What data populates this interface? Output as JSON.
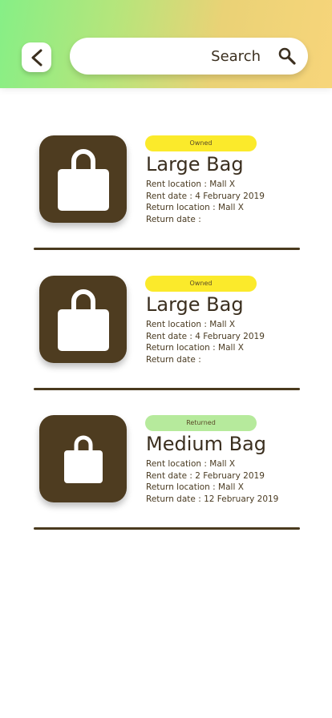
{
  "search": {
    "placeholder": "Search"
  },
  "colors": {
    "owned": "#fbea2b",
    "returned": "#b6ea9c",
    "thumb": "#4e3c20",
    "divider": "#4a3a1e"
  },
  "items": [
    {
      "status": "Owned",
      "title": "Large Bag",
      "rent_location": "Rent location : Mall X",
      "rent_date": "Rent date : 4 February 2019",
      "return_location": "Return location : Mall X",
      "return_date": "Return date :"
    },
    {
      "status": "Owned",
      "title": "Large Bag",
      "rent_location": "Rent location : Mall X",
      "rent_date": "Rent date : 4 February 2019",
      "return_location": "Return location : Mall X",
      "return_date": "Return date :"
    },
    {
      "status": "Returned",
      "title": "Medium Bag",
      "rent_location": "Rent location : Mall X",
      "rent_date": "Rent date : 2 February 2019",
      "return_location": "Return location : Mall X",
      "return_date": "Return date : 12 February 2019"
    }
  ]
}
